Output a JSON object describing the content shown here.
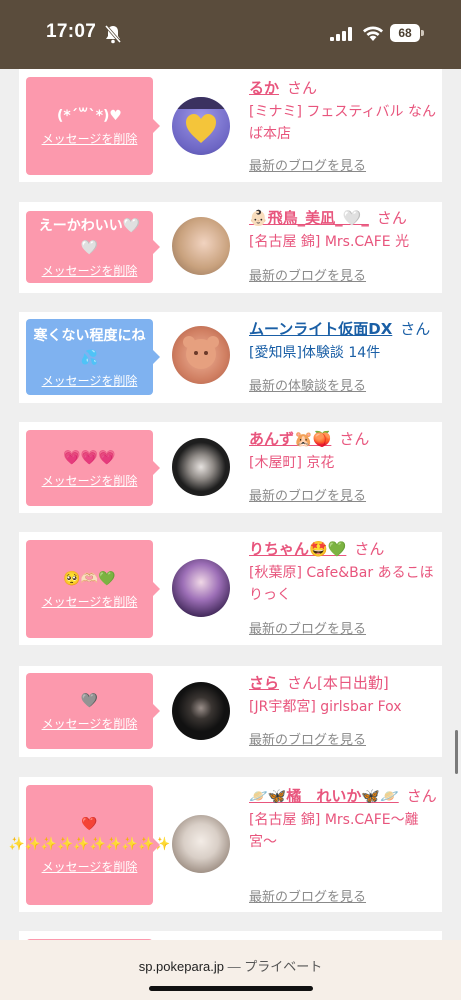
{
  "status": {
    "time": "17:07",
    "battery": "68",
    "icons": [
      "bell-off-icon",
      "signal-icon",
      "wifi-icon",
      "battery-icon"
    ]
  },
  "messages": [
    {
      "bubble_text": "(*´꒳`*)♥",
      "bubble_color": "#fc99ad",
      "delete_label": "メッセージを削除",
      "name": "るか",
      "san": "さん",
      "shop": "[ミナミ] フェスティバル なんば本店",
      "link": "最新のブログを見る",
      "avatar_color": "#7f7ad6"
    },
    {
      "bubble_text": "えーかわいい🤍🤍",
      "bubble_color": "#fc99ad",
      "delete_label": "メッセージを削除",
      "name": "👶🏻飛鳥_美凪_🤍_",
      "san": "さん",
      "shop": "[名古屋 錦] Mrs.CAFE 光",
      "link": "最新のブログを見る",
      "avatar_color": "#c9a27e"
    },
    {
      "bubble_text": "寒くない程度にね💦",
      "bubble_color": "#7fb2f0",
      "delete_label": "メッセージを削除",
      "name": "ムーンライト仮面DX",
      "san": "さん",
      "shop": "[愛知県]体験談 14件",
      "link": "最新の体験談を見る",
      "avatar_color": "#c97a5c"
    },
    {
      "bubble_text": "💗💗💗",
      "bubble_color": "#fc99ad",
      "delete_label": "メッセージを削除",
      "name": "あんず🐹🍑",
      "san": "さん",
      "shop": "[木屋町] 京花",
      "link": "最新のブログを見る",
      "avatar_color": "#2b2b2b"
    },
    {
      "bubble_text": "🥺🫶🏻💚",
      "bubble_color": "#fc99ad",
      "delete_label": "メッセージを削除",
      "name": "りちゃん🤩💚",
      "san": "さん",
      "shop": "[秋葉原] Cafe&Bar あるこほりっく",
      "link": "最新のブログを見る",
      "avatar_color": "#5b3a78"
    },
    {
      "bubble_text": "🩶",
      "bubble_color": "#fc99ad",
      "delete_label": "メッセージを削除",
      "name": "さら",
      "san": "さん[本日出勤]",
      "shop": "[JR宇都宮] girlsbar Fox",
      "link": "最新のブログを見る",
      "avatar_color": "#1c1c1c"
    },
    {
      "bubble_text": "❤️✨✨✨✨✨✨✨✨✨✨",
      "bubble_color": "#fc99ad",
      "delete_label": "メッセージを削除",
      "name": "🪐🦋橘　れいか🦋🪐",
      "san": "さん",
      "shop": "[名古屋 錦] Mrs.CAFE〜離宮〜",
      "link": "最新のブログを見る",
      "avatar_color": "#d9d2cc"
    }
  ],
  "url_bar": {
    "domain": "sp.pokepara.jp",
    "separator": "—",
    "mode": "プライベート"
  }
}
